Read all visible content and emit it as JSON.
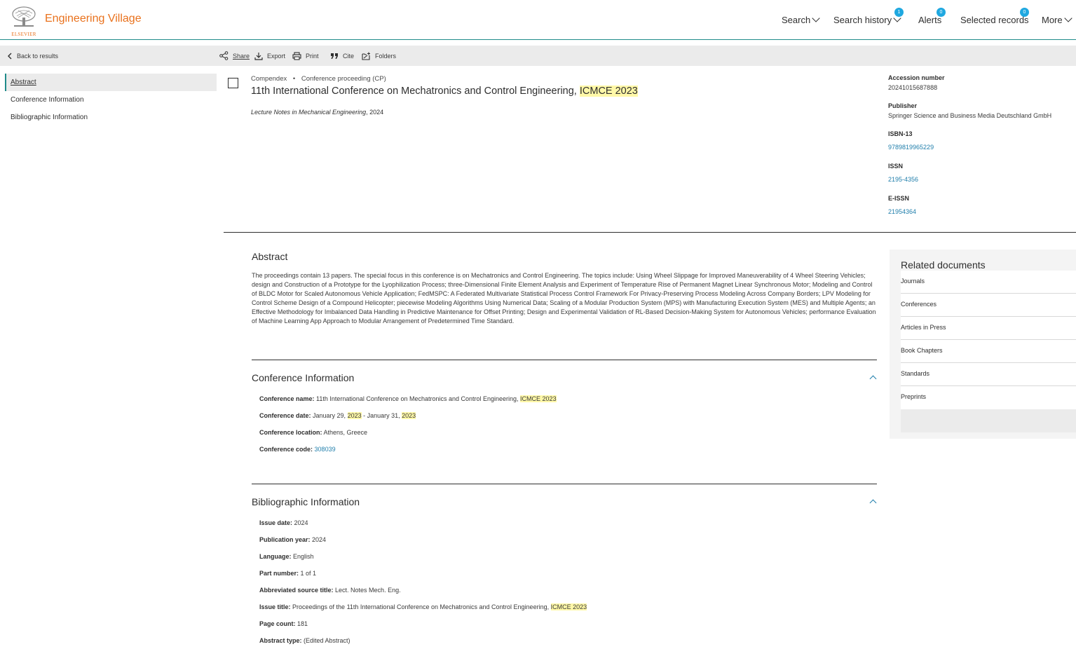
{
  "header": {
    "brand": "Engineering Village",
    "logo_text": "ELSEVIER",
    "nav": {
      "search": "Search",
      "search_history": "Search history",
      "search_history_count": "1",
      "alerts": "Alerts",
      "alerts_count": "0",
      "selected_records": "Selected records",
      "selected_records_count": "0",
      "more": "More"
    }
  },
  "toolbar": {
    "back": "Back to results",
    "share": "Share",
    "export": "Export",
    "print": "Print",
    "cite": "Cite",
    "folders": "Folders"
  },
  "sidebar": {
    "items": [
      {
        "label": "Abstract"
      },
      {
        "label": "Conference Information"
      },
      {
        "label": "Bibliographic Information"
      }
    ]
  },
  "record": {
    "database": "Compendex",
    "bullet": "•",
    "doc_type": "Conference proceeding (CP)",
    "title_plain": "11th International Conference on Mechatronics and Control Engineering, ",
    "title_highlight": "ICMCE 2023",
    "source_title": "Lecture Notes in Mechanical Engineering",
    "source_year": ", 2024"
  },
  "details": {
    "accession_label": "Accession number",
    "accession_value": "20241015687888",
    "publisher_label": "Publisher",
    "publisher_value": "Springer Science and Business Media Deutschland GmbH",
    "isbn_label": "ISBN-13",
    "isbn_value": "9789819965229",
    "issn_label": "ISSN",
    "issn_value": "2195-4356",
    "eissn_label": "E-ISSN",
    "eissn_value": "21954364"
  },
  "abstract": {
    "heading": "Abstract",
    "text": "The proceedings contain 13 papers. The special focus in this conference is on Mechatronics and Control Engineering. The topics include: Using Wheel Slippage for Improved Maneuverability of 4 Wheel Steering Vehicles; design and Construction of a Prototype for the Lyophilization Process; three-Dimensional Finite Element Analysis and Experiment of Temperature Rise of Permanent Magnet Linear Synchronous Motor; Modeling and Control of BLDC Motor for Scaled Autonomous Vehicle Application; FedMSPC: A Federated Multivariate Statistical Process Control Framework For Privacy-Preserving Process Modeling Across Company Borders; LPV Modeling for Control Scheme Design of a Compound Helicopter; piecewise Modeling Algorithms Using Numerical Data; Scaling of a Modular Production System (MPS) with Manufacturing Execution System (MES) and Multiple Agents; an Effective Methodology for Imbalanced Data Handling in Predictive Maintenance for Offset Printing; Design and Experimental Validation of RL-Based Decision-Making System for Autonomous Vehicles; performance Evaluation of Machine Learning App Approach to Modular Arrangement of Predetermined Time Standard."
  },
  "conference": {
    "heading": "Conference Information",
    "name_label": "Conference name:",
    "name_value": " 11th International Conference on Mechatronics and Control Engineering, ",
    "name_highlight": "ICMCE 2023",
    "date_label": "Conference date:",
    "date_part1": " January 29, ",
    "date_hl1": "2023",
    "date_part2": " - January 31, ",
    "date_hl2": "2023",
    "location_label": "Conference location:",
    "location_value": " Athens, Greece",
    "code_label": "Conference code:",
    "code_value": "308039"
  },
  "bibliographic": {
    "heading": "Bibliographic Information",
    "issue_date_label": "Issue date:",
    "issue_date_value": " 2024",
    "pub_year_label": "Publication year:",
    "pub_year_value": " 2024",
    "language_label": "Language:",
    "language_value": " English",
    "part_label": "Part number:",
    "part_value": " 1 of 1",
    "abbr_label": "Abbreviated source title:",
    "abbr_value": " Lect. Notes Mech. Eng.",
    "issue_title_label": "Issue title:",
    "issue_title_value": " Proceedings of the 11th International Conference on Mechatronics and Control Engineering, ",
    "issue_title_highlight": "ICMCE 2023",
    "page_count_label": "Page count:",
    "page_count_value": " 181",
    "abstract_type_label": "Abstract type:",
    "abstract_type_value": " (Edited Abstract)"
  },
  "related": {
    "heading": "Related documents",
    "items": [
      "Journals",
      "Conferences",
      "Articles in Press",
      "Book Chapters",
      "Standards",
      "Preprints"
    ]
  },
  "colors": {
    "brand_orange": "#e9711c",
    "teal_rule": "#1f8b8a",
    "link_blue": "#1f7eab",
    "badge_blue": "#1fa8e0",
    "highlight": "#fff8a8"
  }
}
